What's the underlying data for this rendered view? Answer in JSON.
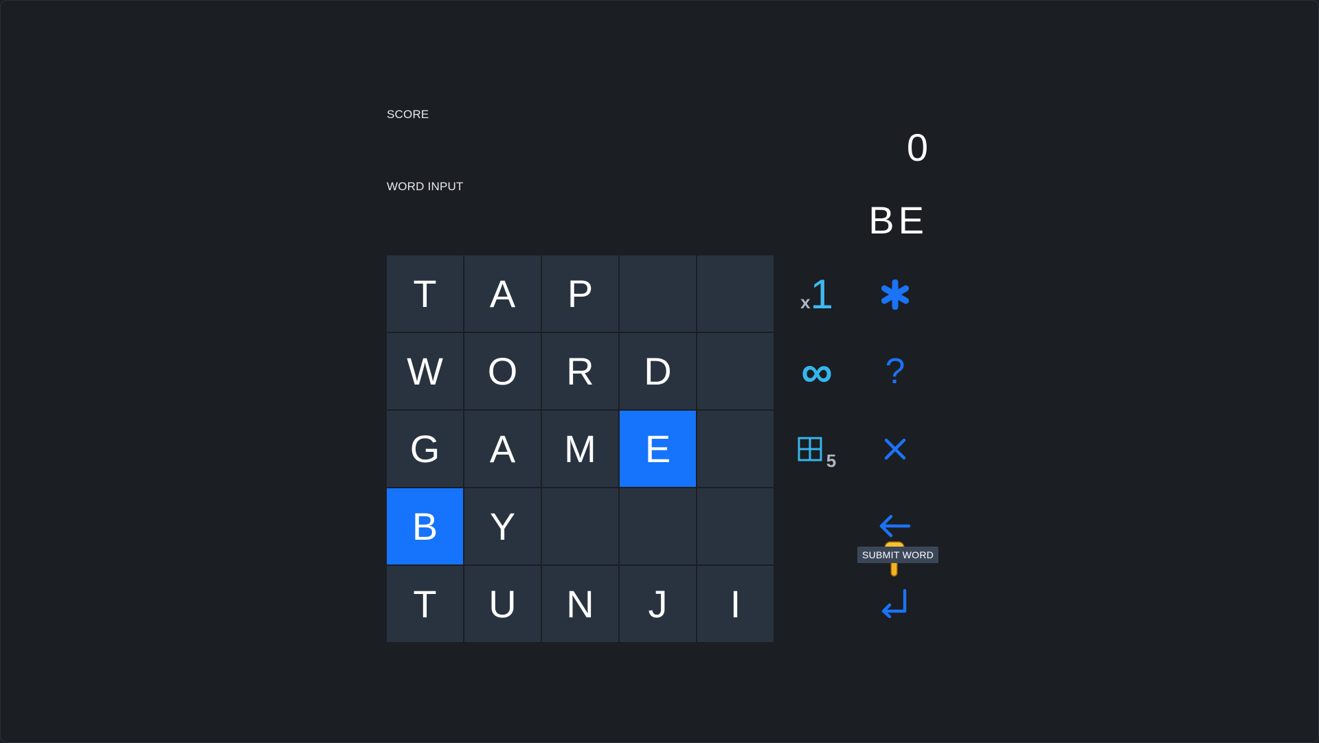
{
  "labels": {
    "score": "SCORE",
    "word_input": "WORD INPUT"
  },
  "score": "0",
  "current_word": "BE",
  "grid": {
    "rows": [
      [
        "T",
        "A",
        "P",
        "",
        ""
      ],
      [
        "W",
        "O",
        "R",
        "D",
        ""
      ],
      [
        "G",
        "A",
        "M",
        "E",
        ""
      ],
      [
        "B",
        "Y",
        "",
        "",
        ""
      ],
      [
        "T",
        "U",
        "N",
        "J",
        "I"
      ]
    ],
    "selected": [
      [
        2,
        3
      ],
      [
        3,
        0
      ]
    ]
  },
  "powerups": {
    "multiplier_prefix": "x",
    "multiplier_value": "1",
    "infinity_glyph": "∞",
    "grid_count": "5"
  },
  "actions": {
    "help_glyph": "?",
    "submit_tooltip": "SUBMIT WORD"
  },
  "icons": [
    "asterisk-icon",
    "question-icon",
    "close-icon",
    "backspace-arrow-icon",
    "enter-icon",
    "grid-icon",
    "infinity-icon",
    "hand-pointer-icon"
  ],
  "colors": {
    "background": "#1b1e23",
    "tile": "#293340",
    "tile_selected": "#1673fb",
    "accent_blue": "#1b73f5",
    "accent_cyan": "#3fb9f0",
    "tooltip_bg": "#3b4759"
  }
}
